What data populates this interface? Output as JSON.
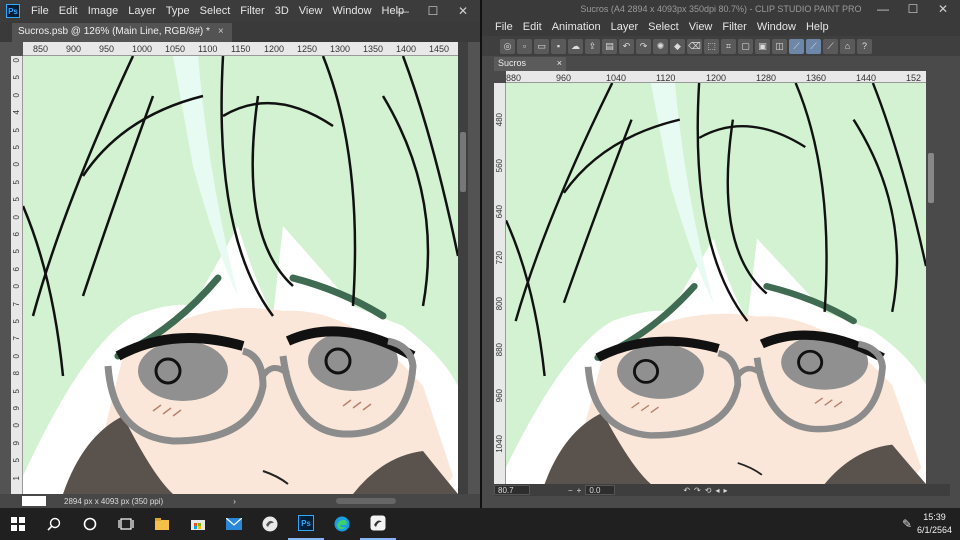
{
  "photoshop": {
    "logo": "Ps",
    "menu": [
      "File",
      "Edit",
      "Image",
      "Layer",
      "Type",
      "Select",
      "Filter",
      "3D",
      "View",
      "Window",
      "Help"
    ],
    "window_controls": [
      "—",
      "☐",
      "✕"
    ],
    "doc_tab": "Sucros.psb @ 126% (Main Line, RGB/8#) *",
    "doc_tab_close": "×",
    "ruler_top": [
      "850",
      "900",
      "950",
      "1000",
      "1050",
      "1100",
      "1150",
      "1200",
      "1250",
      "1300",
      "1350",
      "1400",
      "1450"
    ],
    "ruler_left": [
      "0",
      "5",
      "0",
      "4",
      "5",
      "5",
      "0",
      "5",
      "5",
      "0",
      "6",
      "5",
      "6",
      "0",
      "7",
      "5",
      "7",
      "0",
      "8",
      "5",
      "9",
      "0",
      "9",
      "5",
      "1"
    ],
    "status_text": "2894 px x 4093 px (350 ppi)",
    "status_arrow": "›"
  },
  "csp": {
    "title": "Sucros (A4 2894 x 4093px 350dpi 80.7%) - CLIP STUDIO PAINT PRO",
    "menu": [
      "File",
      "Edit",
      "Animation",
      "Layer",
      "Select",
      "View",
      "Filter",
      "Window",
      "Help"
    ],
    "window_controls": [
      "—",
      "☐",
      "✕"
    ],
    "doc_tab": "Sucros",
    "doc_tab_close": "×",
    "ruler_top": [
      "880",
      "960",
      "1040",
      "1120",
      "1200",
      "1280",
      "1360",
      "1440",
      "152"
    ],
    "ruler_left": [
      "480",
      "560",
      "640",
      "720",
      "800",
      "880",
      "960",
      "1040"
    ],
    "zoom": "80.7",
    "angle": "0.0",
    "status_minus": "−",
    "status_plus": "+"
  },
  "taskbar": {
    "time": "15:39",
    "date": "6/1/2564",
    "icons": [
      "start-icon",
      "search-icon",
      "cortana-icon",
      "task-view-icon",
      "file-explorer-icon",
      "store-icon",
      "mail-icon",
      "clip-studio-launcher-icon",
      "photoshop-icon",
      "edge-icon",
      "clip-studio-paint-icon"
    ]
  },
  "colors": {
    "hair": "#d3f2d2",
    "hair_highlight": "#e8fbf2",
    "skin": "#fbe7da",
    "glasses": "#8c8c8c",
    "iris": "#909090",
    "scarf": "#5a524c",
    "brow": "#3f6b52"
  }
}
